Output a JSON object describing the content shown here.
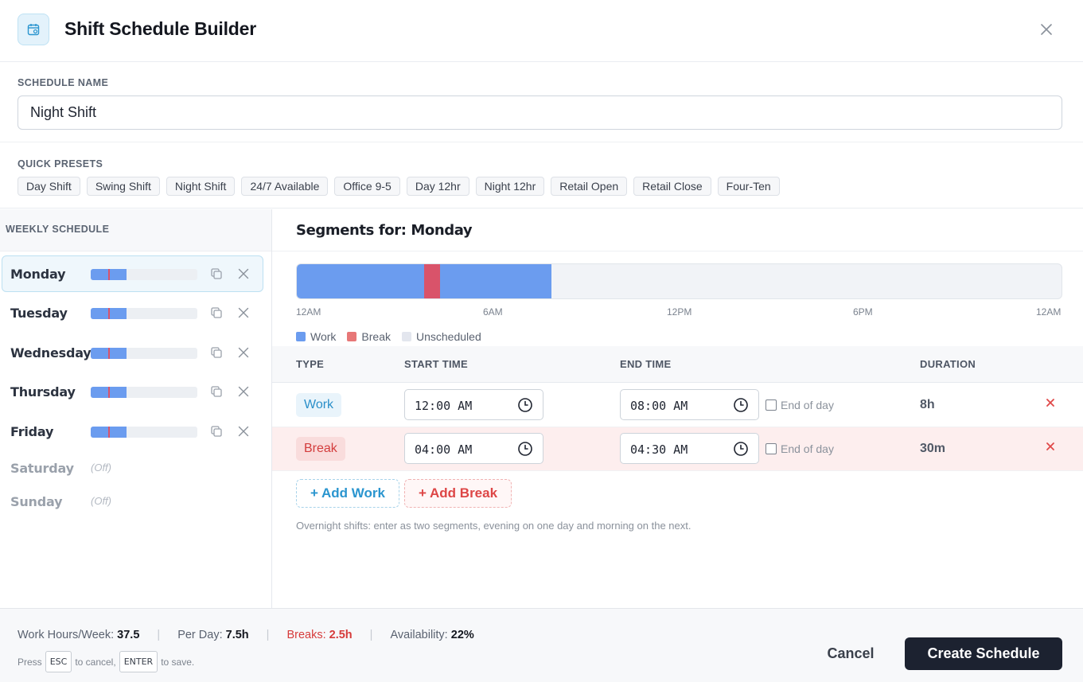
{
  "header": {
    "title": "Shift Schedule Builder",
    "icon": "calendar-icon",
    "close_icon": "close-icon"
  },
  "schedule_name": {
    "label": "SCHEDULE NAME",
    "value": "Night Shift"
  },
  "presets": {
    "label": "QUICK PRESETS",
    "items": [
      "Day Shift",
      "Swing Shift",
      "Night Shift",
      "24/7 Available",
      "Office 9-5",
      "Day 12hr",
      "Night 12hr",
      "Retail Open",
      "Retail Close",
      "Four-Ten"
    ]
  },
  "weekly": {
    "label": "WEEKLY SCHEDULE",
    "days": [
      {
        "name": "Monday",
        "active": true,
        "off": false,
        "off_label": ""
      },
      {
        "name": "Tuesday",
        "active": false,
        "off": false,
        "off_label": ""
      },
      {
        "name": "Wednesday",
        "active": false,
        "off": false,
        "off_label": ""
      },
      {
        "name": "Thursday",
        "active": false,
        "off": false,
        "off_label": ""
      },
      {
        "name": "Friday",
        "active": false,
        "off": false,
        "off_label": ""
      },
      {
        "name": "Saturday",
        "active": false,
        "off": true,
        "off_label": "(Off)"
      },
      {
        "name": "Sunday",
        "active": false,
        "off": true,
        "off_label": "(Off)"
      }
    ]
  },
  "segments": {
    "title": "Segments for: Monday",
    "timeline": {
      "ticks": [
        "12AM",
        "6AM",
        "12PM",
        "6PM",
        "12AM"
      ],
      "work_hours": [
        0,
        8
      ],
      "break_hours": [
        4,
        4.5
      ],
      "colors": {
        "work": "#6b9cef",
        "break": "#d9536a",
        "unscheduled": "#f1f3f7"
      }
    },
    "legend": {
      "work": "Work",
      "break": "Break",
      "unscheduled": "Unscheduled"
    },
    "columns": {
      "type": "TYPE",
      "start": "START TIME",
      "end": "END TIME",
      "duration": "DURATION"
    },
    "rows": [
      {
        "type": "Work",
        "start": "12:00 AM",
        "end": "08:00 AM",
        "eod_label": "End of day",
        "duration": "8h"
      },
      {
        "type": "Break",
        "start": "04:00 AM",
        "end": "04:30 AM",
        "eod_label": "End of day",
        "duration": "30m"
      }
    ],
    "add_work": "+ Add Work",
    "add_break": "+ Add Break",
    "hint": "Overnight shifts: enter as two segments, evening on one day and morning on the next."
  },
  "footer": {
    "work_hours_label": "Work Hours/Week:",
    "work_hours_value": "37.5",
    "per_day_label": "Per Day:",
    "per_day_value": "7.5h",
    "breaks_label": "Breaks:",
    "breaks_value": "2.5h",
    "availability_label": "Availability:",
    "availability_value": "22%",
    "kbd_press": "Press",
    "kbd_esc": "ESC",
    "kbd_to_cancel": "to cancel,",
    "kbd_enter": "ENTER",
    "kbd_to_save": "to save.",
    "cancel_label": "Cancel",
    "create_label": "Create Schedule"
  }
}
